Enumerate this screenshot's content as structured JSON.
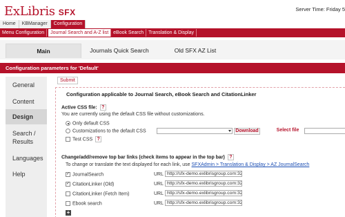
{
  "header": {
    "logo_main": "ExLibris",
    "logo_product": "SFX",
    "server_time": "Server Time: Friday 5"
  },
  "breadcrumbs": [
    "Home",
    "KBManager",
    "Configuration"
  ],
  "menu": {
    "items": [
      "Menu Configuration",
      "Journal Search and A-Z list",
      "eBook Search",
      "Translation & Display"
    ]
  },
  "tabs": [
    "Main",
    "Journals Quick Search",
    "Old SFX AZ List"
  ],
  "section": {
    "title": "Configuration parameters for 'Default'"
  },
  "sidebar": {
    "items": [
      "General",
      "Content",
      "Design",
      "Search /",
      "Results",
      "Languages",
      "Help"
    ]
  },
  "content": {
    "submit_label": "Submit",
    "panel_title": "Configuration applicable to Journal Search, eBook Search and CitationLinker",
    "css": {
      "label": "Active CSS file:",
      "help": "?",
      "description": "You are currently using the default CSS file without customizations.",
      "options": [
        "Only default CSS",
        "Customizations to the default CSS",
        "Test CSS"
      ],
      "download_label": "Download",
      "select_file_label": "Select file"
    },
    "topbar": {
      "label": "Change/add/remove top bar links (check items to appear in the top bar)",
      "help": "?",
      "note_prefix": "To change or translate the text displayed for each link, use",
      "note_link": "SFXAdmin > Translation & Display > AZ JournalSearch",
      "url_label": "URL",
      "links": [
        {
          "name": "JournalSearch",
          "checked": true,
          "url": "http://sfx-demo.exlibrisgroup.com:3210/s"
        },
        {
          "name": "CitationLinker (Old)",
          "checked": true,
          "url": "http://sfx-demo.exlibrisgroup.com:3210/s"
        },
        {
          "name": "CitationLinker (Fetch Item)",
          "checked": false,
          "url": "http://sfx-demo.exlibrisgroup.com:3210/s"
        },
        {
          "name": "Ebook search",
          "checked": false,
          "url": "http://sfx-demo.exlibrisgroup.com:3210/s"
        }
      ],
      "add_icon": "+"
    }
  },
  "colors": {
    "brand": "#b5122a",
    "link": "#1a4db3"
  }
}
